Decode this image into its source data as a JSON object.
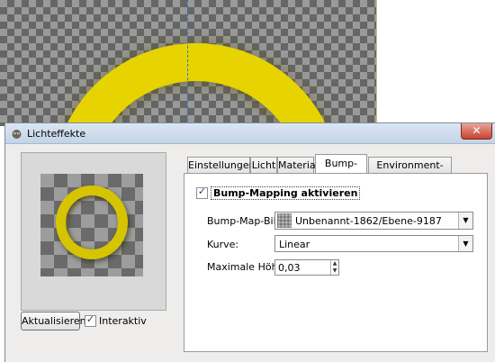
{
  "window": {
    "title": "Lichteffekte",
    "close_label": "✕"
  },
  "preview": {
    "update_button": "Aktualisieren",
    "interactive_label": "Interaktiv",
    "interactive_checked": true
  },
  "tabs": [
    {
      "label": "Einstellungen"
    },
    {
      "label": "Licht"
    },
    {
      "label": "Material"
    },
    {
      "label": "Bump-Map"
    },
    {
      "label": "Environment-Map"
    }
  ],
  "active_tab": "Bump-Map",
  "bump_map": {
    "enable_label": "Bump-Mapping aktivieren",
    "enable_checked": true,
    "image_label": "Bump-Map-Bild:",
    "image_value": "Unbenannt-1862/Ebene-9187",
    "curve_label": "Kurve:",
    "curve_value": "Linear",
    "max_height_label": "Maximale Höhe:",
    "max_height_value": "0,03"
  },
  "colors": {
    "ring_yellow": "#e7d300",
    "titlebar": "#c3d3e6",
    "dialog_bg": "#eeedeb"
  }
}
